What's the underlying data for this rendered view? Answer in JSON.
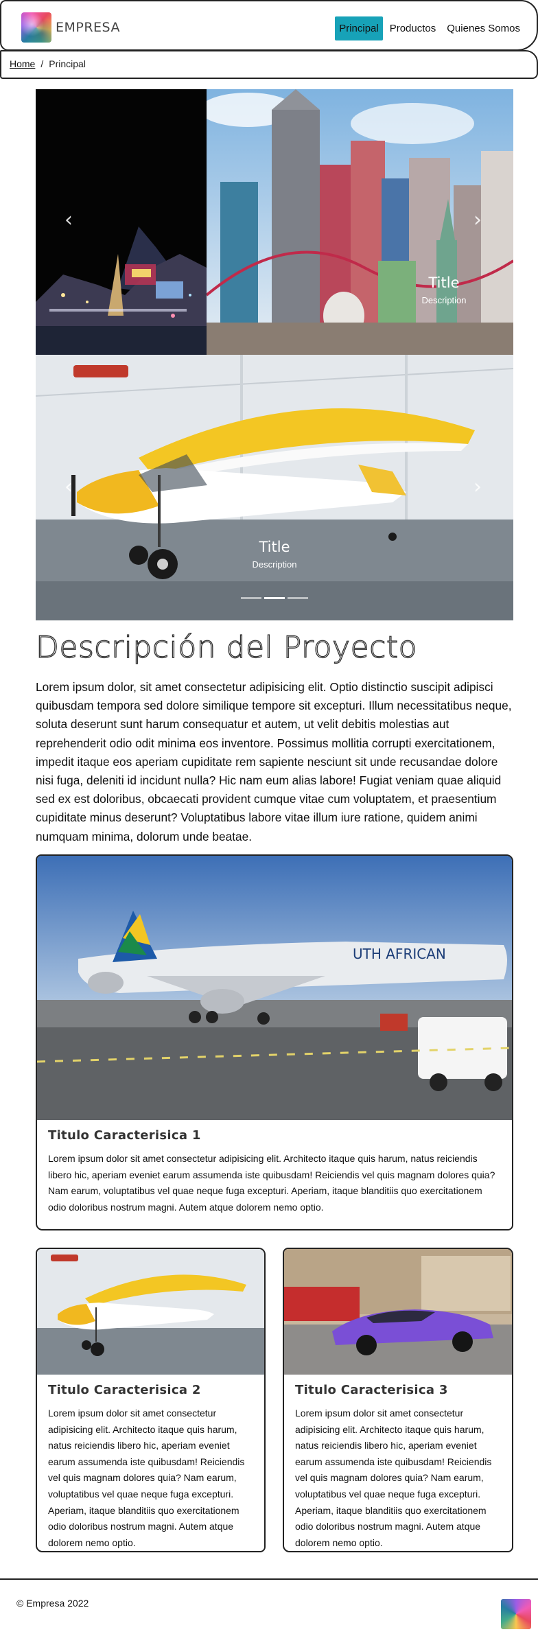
{
  "navbar": {
    "brand": "EMPRESA",
    "logo_icon": "colorful-abstract-logo",
    "links": [
      {
        "label": "Principal",
        "active": true
      },
      {
        "label": "Productos",
        "active": false
      },
      {
        "label": "Quienes Somos",
        "active": false
      }
    ],
    "accent_color": "#17a2b8"
  },
  "breadcrumb": {
    "home": "Home",
    "separator": "/",
    "current": "Principal"
  },
  "carousel": {
    "prev_icon": "chevron-left-icon",
    "next_icon": "chevron-right-icon",
    "slides": [
      {
        "image": "las-vegas-new-york-hotel-photo",
        "title": "Title",
        "description": "Description"
      },
      {
        "image": "yellow-white-light-aircraft-hangar-photo",
        "title": "Title",
        "description": "Description"
      }
    ],
    "indicators": 3,
    "active_indicator": 1
  },
  "description": {
    "title": "Descripción del Proyecto",
    "text": "Lorem ipsum dolor, sit amet consectetur adipisicing elit. Optio distinctio suscipit adipisci quibusdam tempora sed dolore similique tempore sit excepturi. Illum necessitatibus neque, soluta deserunt sunt harum consequatur et autem, ut velit debitis molestias aut reprehenderit odio odit minima eos inventore. Possimus mollitia corrupti exercitationem, impedit itaque eos aperiam cupiditate rem sapiente nesciunt sit unde recusandae dolore nisi fuga, deleniti id incidunt nulla? Hic nam eum alias labore! Fugiat veniam quae aliquid sed ex est doloribus, obcaecati provident cumque vitae cum voluptatem, et praesentium cupiditate minus deserunt? Voluptatibus labore vitae illum iure ratione, quidem animi numquam minima, dolorum unde beatae."
  },
  "cards": [
    {
      "image": "south-african-airliner-photo",
      "title": "Titulo Caracterisica 1",
      "text": "Lorem ipsum dolor sit amet consectetur adipisicing elit. Architecto itaque quis harum, natus reiciendis libero hic, aperiam eveniet earum assumenda iste quibusdam! Reiciendis vel quis magnam dolores quia? Nam earum, voluptatibus vel quae neque fuga excepturi. Aperiam, itaque blanditiis quo exercitationem odio doloribus nostrum magni. Autem atque dolorem nemo optio."
    },
    {
      "image": "light-aircraft-hangar-photo",
      "title": "Titulo Caracterisica 2",
      "text": "Lorem ipsum dolor sit amet consectetur adipisicing elit. Architecto itaque quis harum, natus reiciendis libero hic, aperiam eveniet earum assumenda iste quibusdam! Reiciendis vel quis magnam dolores quia? Nam earum, voluptatibus vel quae neque fuga excepturi. Aperiam, itaque blanditiis quo exercitationem odio doloribus nostrum magni. Autem atque dolorem nemo optio."
    },
    {
      "image": "purple-sports-car-photo",
      "title": "Titulo Caracterisica 3",
      "text": "Lorem ipsum dolor sit amet consectetur adipisicing elit. Architecto itaque quis harum, natus reiciendis libero hic, aperiam eveniet earum assumenda iste quibusdam! Reiciendis vel quis magnam dolores quia? Nam earum, voluptatibus vel quae neque fuga excepturi. Aperiam, itaque blanditiis quo exercitationem odio doloribus nostrum magni. Autem atque dolorem nemo optio."
    }
  ],
  "footer": {
    "copyright": "© Empresa 2022",
    "logo_icon": "colorful-abstract-logo"
  }
}
